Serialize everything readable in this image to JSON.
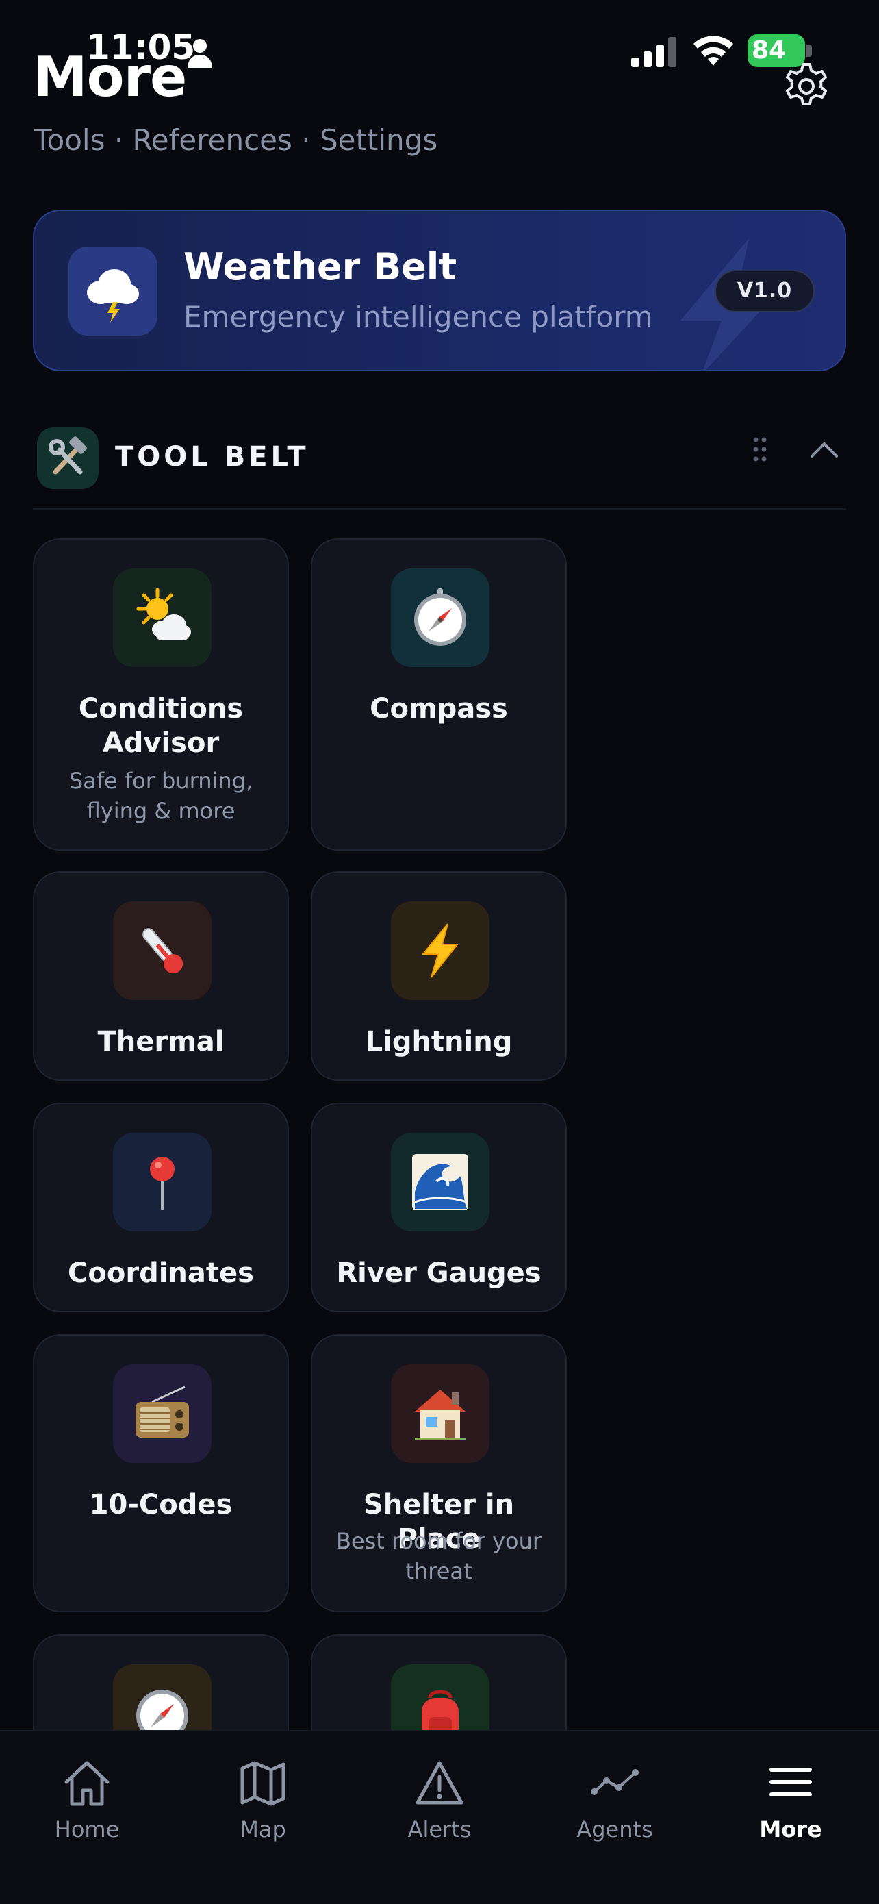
{
  "status_bar": {
    "time": "11:05",
    "battery": "84"
  },
  "header": {
    "title": "More",
    "subtitle": "Tools · References · Settings"
  },
  "hero": {
    "title": "Weather Belt",
    "subtitle": "Emergency intelligence platform",
    "version": "V1.0",
    "icon": "cloud-lightning-icon"
  },
  "section": {
    "title": "TOOL BELT",
    "icon": "hammer-wrench-icon"
  },
  "tools": [
    {
      "title": "Conditions Advisor",
      "subtitle": "Safe for burning, flying & more",
      "icon": "sun-cloud-icon",
      "bg": "#15261f"
    },
    {
      "title": "Compass",
      "subtitle": "",
      "icon": "compass-icon",
      "bg": "#11303a"
    },
    {
      "title": "Thermal",
      "subtitle": "",
      "icon": "thermometer-icon",
      "bg": "#2a1d1b"
    },
    {
      "title": "Lightning",
      "subtitle": "",
      "icon": "lightning-icon",
      "bg": "#2b2316"
    },
    {
      "title": "Coordinates",
      "subtitle": "",
      "icon": "pin-icon",
      "bg": "#18223a"
    },
    {
      "title": "River Gauges",
      "subtitle": "",
      "icon": "wave-icon",
      "bg": "#122a2c"
    },
    {
      "title": "10-Codes",
      "subtitle": "",
      "icon": "radio-icon",
      "bg": "#211d3a"
    },
    {
      "title": "Shelter in Place",
      "subtitle": "Best room for your threat",
      "icon": "house-icon",
      "bg": "#2a1a1e"
    },
    {
      "title": "",
      "subtitle": "",
      "icon": "compass-icon",
      "bg": "#2c2417"
    },
    {
      "title": "",
      "subtitle": "",
      "icon": "backpack-icon",
      "bg": "#14301f"
    }
  ],
  "tab_bar": {
    "items": [
      {
        "label": "Home",
        "icon": "home-icon",
        "active": false
      },
      {
        "label": "Map",
        "icon": "map-icon",
        "active": false
      },
      {
        "label": "Alerts",
        "icon": "alert-triangle-icon",
        "active": false
      },
      {
        "label": "Agents",
        "icon": "agents-graph-icon",
        "active": false
      },
      {
        "label": "More",
        "icon": "menu-icon",
        "active": true
      }
    ]
  },
  "colors": {
    "background": "#07090e",
    "hero_background": "#1b2a6a",
    "tile_background": "#12151d",
    "battery": "#34c759"
  }
}
